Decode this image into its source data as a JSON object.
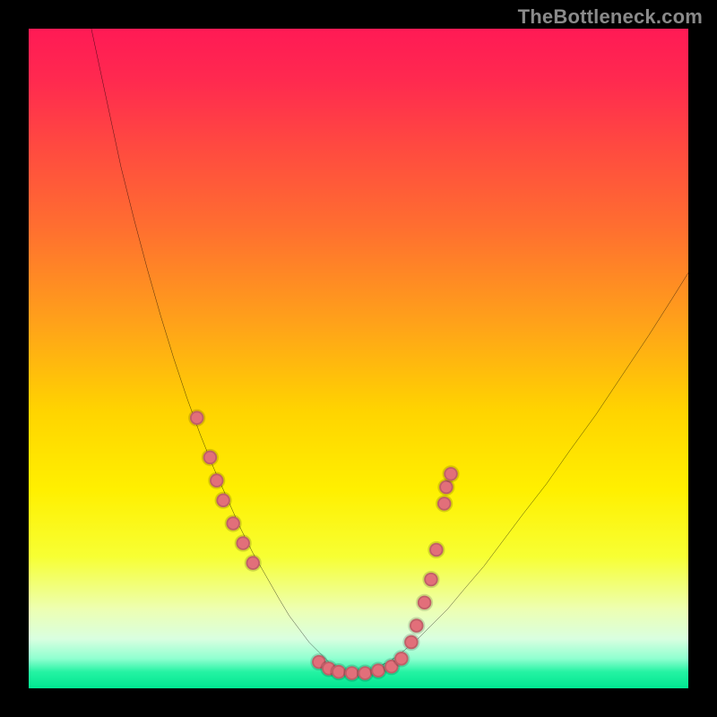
{
  "watermark": "TheBottleneck.com",
  "colors": {
    "bg": "#000000",
    "dot": "#e26f7a",
    "curve": "#000000",
    "gradient_stops": [
      {
        "offset": 0.0,
        "color": "#ff1a55"
      },
      {
        "offset": 0.08,
        "color": "#ff2a4f"
      },
      {
        "offset": 0.18,
        "color": "#ff4a40"
      },
      {
        "offset": 0.3,
        "color": "#ff6e30"
      },
      {
        "offset": 0.45,
        "color": "#ffa319"
      },
      {
        "offset": 0.58,
        "color": "#ffd400"
      },
      {
        "offset": 0.7,
        "color": "#fff000"
      },
      {
        "offset": 0.8,
        "color": "#f7ff33"
      },
      {
        "offset": 0.88,
        "color": "#edffb2"
      },
      {
        "offset": 0.925,
        "color": "#d9ffe0"
      },
      {
        "offset": 0.955,
        "color": "#8fffd0"
      },
      {
        "offset": 0.975,
        "color": "#25f3a3"
      },
      {
        "offset": 1.0,
        "color": "#00e691"
      }
    ]
  },
  "chart_data": {
    "type": "line",
    "title": "",
    "xlabel": "",
    "ylabel": "",
    "x_range": [
      0,
      100
    ],
    "y_range": [
      0,
      100
    ],
    "series": [
      {
        "name": "left-curve",
        "x": [
          9.5,
          11.0,
          12.5,
          14.0,
          16.0,
          18.0,
          20.0,
          22.0,
          24.0,
          26.0,
          28.0,
          30.0,
          32.0,
          34.0,
          36.0,
          38.0,
          39.5,
          41.0,
          42.5,
          44.0,
          45.5,
          47.0,
          48.0,
          49.0
        ],
        "y": [
          100.0,
          93.0,
          86.0,
          79.0,
          71.0,
          63.5,
          56.5,
          50.0,
          44.0,
          38.5,
          33.5,
          29.0,
          24.5,
          20.5,
          17.0,
          13.5,
          11.0,
          9.0,
          7.0,
          5.5,
          4.0,
          3.0,
          2.3,
          2.0
        ]
      },
      {
        "name": "right-curve",
        "x": [
          49.0,
          50.5,
          52.0,
          53.5,
          55.0,
          57.0,
          59.0,
          61.0,
          63.5,
          66.0,
          69.0,
          72.0,
          75.0,
          78.5,
          82.0,
          86.0,
          90.0,
          94.0,
          97.5,
          100.0
        ],
        "y": [
          2.0,
          2.3,
          2.8,
          3.5,
          4.3,
          5.8,
          7.5,
          9.5,
          12.0,
          15.0,
          18.5,
          22.5,
          26.5,
          31.0,
          36.0,
          41.5,
          47.5,
          53.5,
          59.0,
          63.0
        ]
      }
    ],
    "markers": {
      "name": "data-dots",
      "points": [
        {
          "x": 25.5,
          "y": 41.0
        },
        {
          "x": 27.5,
          "y": 35.0
        },
        {
          "x": 28.5,
          "y": 31.5
        },
        {
          "x": 29.5,
          "y": 28.5
        },
        {
          "x": 31.0,
          "y": 25.0
        },
        {
          "x": 32.5,
          "y": 22.0
        },
        {
          "x": 34.0,
          "y": 19.0
        },
        {
          "x": 44.0,
          "y": 4.0
        },
        {
          "x": 45.5,
          "y": 3.0
        },
        {
          "x": 47.0,
          "y": 2.5
        },
        {
          "x": 49.0,
          "y": 2.3
        },
        {
          "x": 51.0,
          "y": 2.3
        },
        {
          "x": 53.0,
          "y": 2.7
        },
        {
          "x": 55.0,
          "y": 3.3
        },
        {
          "x": 56.5,
          "y": 4.5
        },
        {
          "x": 58.0,
          "y": 7.0
        },
        {
          "x": 58.8,
          "y": 9.5
        },
        {
          "x": 60.0,
          "y": 13.0
        },
        {
          "x": 61.0,
          "y": 16.5
        },
        {
          "x": 61.8,
          "y": 21.0
        },
        {
          "x": 63.0,
          "y": 28.0
        },
        {
          "x": 63.3,
          "y": 30.5
        },
        {
          "x": 64.0,
          "y": 32.5
        }
      ]
    }
  }
}
